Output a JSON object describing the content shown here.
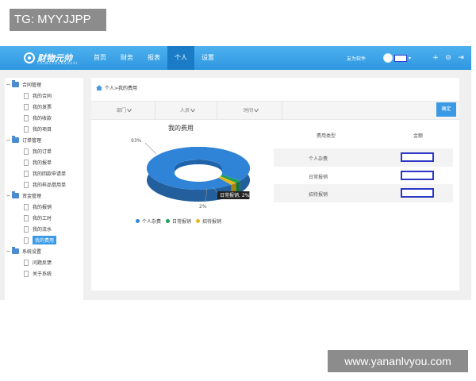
{
  "tags": {
    "top_left": "TG: MYYJJPP",
    "bottom_right": "www.yananlvyou.com"
  },
  "header": {
    "logo_text": "财物元帅",
    "logo_sub": "CAIWUYUANSHUAI",
    "nav": [
      "首页",
      "财务",
      "报表",
      "个人",
      "设置"
    ],
    "active_nav_index": 3,
    "friend_link": "友为软件",
    "colors": {
      "bar": "#2f97e0",
      "active": "#1a7cc6"
    }
  },
  "sidebar": {
    "groups": [
      {
        "label": "合同管理",
        "items": [
          "我的合同",
          "我的发票",
          "我的收款",
          "我的项目"
        ]
      },
      {
        "label": "订单管理",
        "items": [
          "我的订单",
          "我的报单",
          "我的回款申请单",
          "我的样品借用单"
        ]
      },
      {
        "label": "资金管理",
        "items": [
          "我的报销",
          "我的工时",
          "我的流水",
          "我的费用"
        ]
      },
      {
        "label": "系统设置",
        "items": [
          "问题反馈",
          "关于系统"
        ]
      }
    ],
    "active_item": "我的费用"
  },
  "content": {
    "breadcrumb": "个人>我的费用",
    "filters": [
      "部门",
      "人员",
      "时间"
    ],
    "confirm_label": "确定",
    "chart_title": "我的费用",
    "table": {
      "headers": [
        "费用类型",
        "金额"
      ],
      "rows": [
        {
          "type": "个人杂费"
        },
        {
          "type": "日常报销"
        },
        {
          "type": "招待报销"
        }
      ]
    }
  },
  "chart_data": {
    "type": "pie",
    "title": "我的费用",
    "categories": [
      "个人杂费",
      "日常报销",
      "招待报销"
    ],
    "values": [
      93,
      2,
      2
    ],
    "slice_labels": [
      "93%",
      "日常报销, 2%",
      "2%"
    ],
    "colors": [
      "#2f84d8",
      "#1e9e5a",
      "#e3b81e"
    ],
    "legend_position": "bottom"
  }
}
